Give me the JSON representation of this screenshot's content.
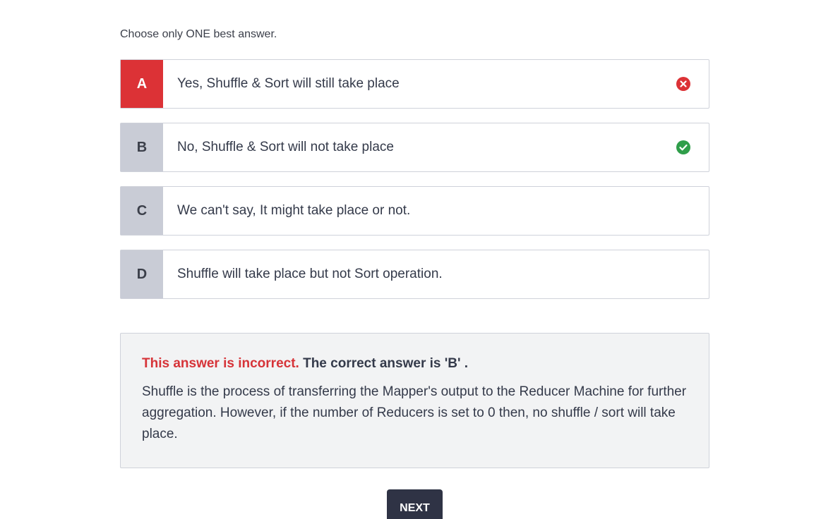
{
  "instruction": "Choose only ONE best answer.",
  "options": [
    {
      "letter": "A",
      "text": "Yes, Shuffle & Sort will still take place",
      "state": "selected-wrong",
      "icon": "x-circle-icon",
      "icon_color": "#dc3236"
    },
    {
      "letter": "B",
      "text": "No, Shuffle & Sort will not take place",
      "state": "correct",
      "icon": "check-circle-icon",
      "icon_color": "#2f9e4a"
    },
    {
      "letter": "C",
      "text": "We can't say, It might take place or not.",
      "state": "none"
    },
    {
      "letter": "D",
      "text": "Shuffle will take place but not Sort operation.",
      "state": "none"
    }
  ],
  "feedback": {
    "incorrect_label": "This answer is incorrect.",
    "correct_label": "The correct answer is 'B' .",
    "explanation": "Shuffle is the process of transferring the Mapper's output to the Reducer Machine for further aggregation. However, if the number of Reducers is set to 0 then, no shuffle / sort will take place."
  },
  "next_button": "NEXT",
  "colors": {
    "incorrect": "#dc3236",
    "correct": "#2f9e4a",
    "button_bg": "#2f3345",
    "feedback_bg": "#f2f3f4"
  }
}
